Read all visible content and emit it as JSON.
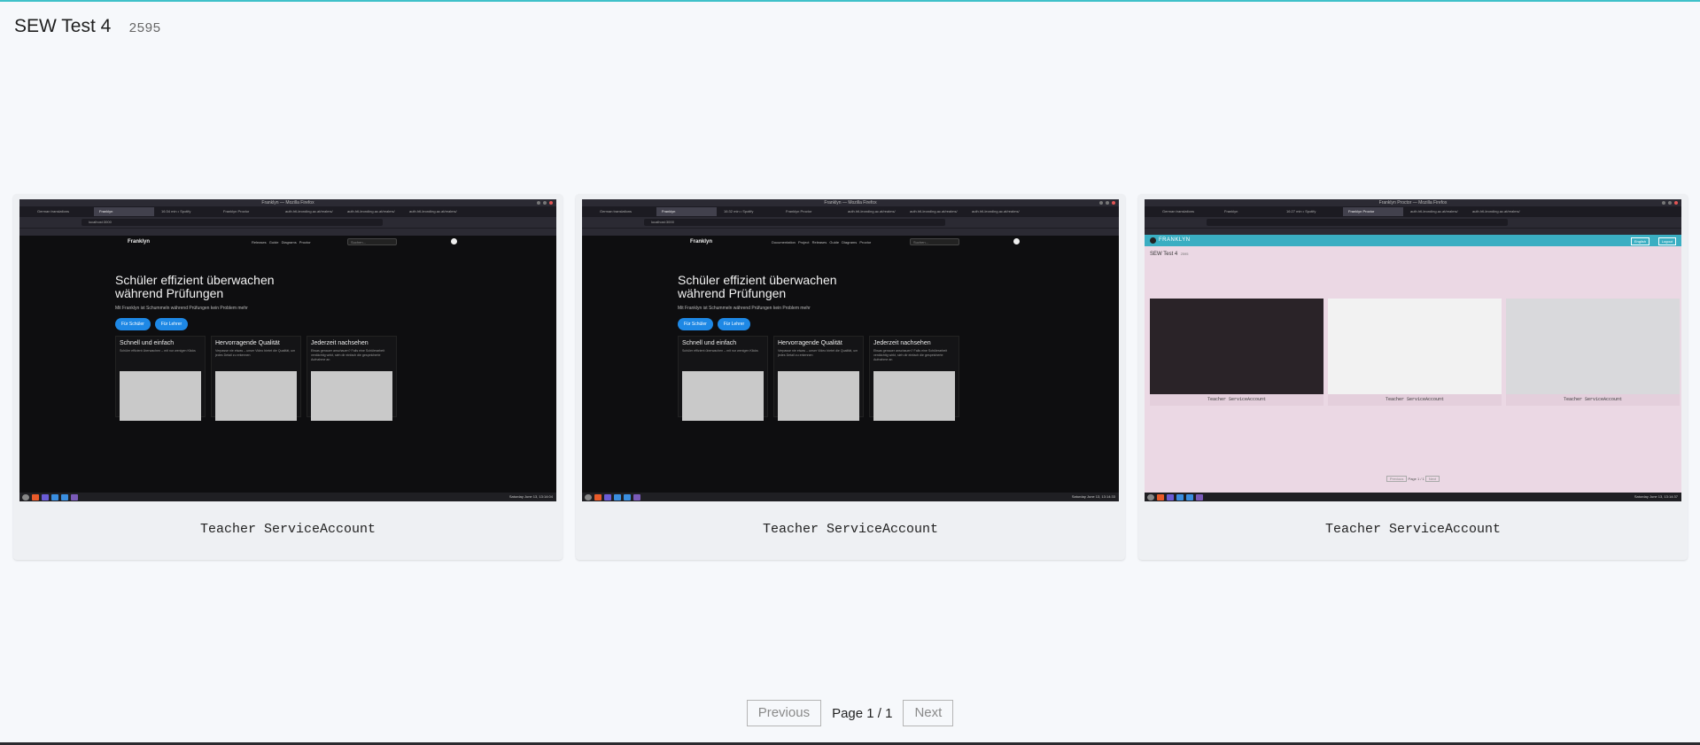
{
  "header": {
    "title": "SEW Test 4",
    "exam_id": "2595"
  },
  "screenshots": [
    {
      "label": "Teacher ServiceAccount",
      "window_title": "Franklyn — Mozilla Firefox",
      "tabs": [
        "German translations",
        "Franklyn",
        "16:34 min • Spotify",
        "Franklyn Proctor",
        "auth.htl-leonding.ac.at/realms/",
        "auth.htl-leonding.ac.at/realms/",
        "auth.htl-leonding.ac.at/realms/"
      ],
      "url": "localhost:3000",
      "brand": "Franklyn",
      "nav_links": "Releases Guide Diagrams Proctor",
      "search": "Suchen...",
      "hero_line1": "Schüler effizient überwachen",
      "hero_line2": "während Prüfungen",
      "hero_sub": "Mit Franklyn ist Schummeln während Prüfungen kein Problem mehr",
      "btn_student": "Für Schüler",
      "btn_teacher": "Für Lehrer",
      "features": [
        {
          "title": "Schnell und einfach",
          "desc": "Schüler effizient überwachen – mit nur wenigen Klicks"
        },
        {
          "title": "Hervorragende Qualität",
          "desc": "Verpasse nie etwas – unser Video bietet die Qualität, um jedes Detail zu erkennen"
        },
        {
          "title": "Jederzeit nachsehen",
          "desc": "Etwas genauer anschauen? Falls eine Schülerarbeit verdächtig wirkt, sieh dir einfach die gespeicherte Aufnahme an"
        }
      ],
      "clock": "Saturday June 13, 13:14:04"
    },
    {
      "label": "Teacher ServiceAccount",
      "window_title": "Franklyn — Mozilla Firefox",
      "tabs": [
        "German translations",
        "Franklyn",
        "16:32 min • Spotify",
        "Franklyn Proctor",
        "auth.htl-leonding.ac.at/realms/",
        "auth.htl-leonding.ac.at/realms/",
        "auth.htl-leonding.ac.at/realms/"
      ],
      "url": "localhost:3000",
      "brand": "Franklyn",
      "nav_links": "Documentation Project Releases Guide Diagrams Proctor",
      "search": "Suchen...",
      "hero_line1": "Schüler effizient überwachen",
      "hero_line2": "während Prüfungen",
      "hero_sub": "Mit Franklyn ist Schummeln während Prüfungen kein Problem mehr",
      "btn_student": "Für Schüler",
      "btn_teacher": "Für Lehrer",
      "features": [
        {
          "title": "Schnell und einfach",
          "desc": "Schüler effizient überwachen – mit nur wenigen Klicks"
        },
        {
          "title": "Hervorragende Qualität",
          "desc": "Verpasse nie etwas – unser Video bietet die Qualität, um jedes Detail zu erkennen"
        },
        {
          "title": "Jederzeit nachsehen",
          "desc": "Etwas genauer anschauen? Falls eine Schülerarbeit verdächtig wirkt, sieh dir einfach die gespeicherte Aufnahme an"
        }
      ],
      "clock": "Saturday June 13, 13:14:33"
    },
    {
      "label": "Teacher ServiceAccount",
      "window_title": "Franklyn Proctor — Mozilla Firefox",
      "tabs": [
        "German translations",
        "Franklyn",
        "16:27 min • Spotify",
        "Franklyn Proctor",
        "auth.htl-leonding.ac.at/realms/",
        "auth.htl-leonding.ac.at/realms/"
      ],
      "brand": "FRANKLYN",
      "btn_english": "English",
      "btn_logout": "Logout",
      "exam_title": "SEW Test 4",
      "exam_id": "2595",
      "inner_labels": [
        "Teacher ServiceAccount",
        "Teacher ServiceAccount",
        "Teacher ServiceAccount"
      ],
      "inner_prev": "Previous",
      "inner_page": "Page 1 / 1",
      "inner_next": "Next",
      "clock": "Saturday June 13, 13:14:37"
    }
  ],
  "pagination": {
    "previous": "Previous",
    "page_info": "Page 1 / 1",
    "next": "Next"
  },
  "colors": {
    "accent": "#3fc1c9",
    "card_bg": "#eef0f3",
    "proctor_header": "#3aaec2",
    "proctor_bg": "#ebd8e4",
    "button_blue": "#1e88e5"
  }
}
